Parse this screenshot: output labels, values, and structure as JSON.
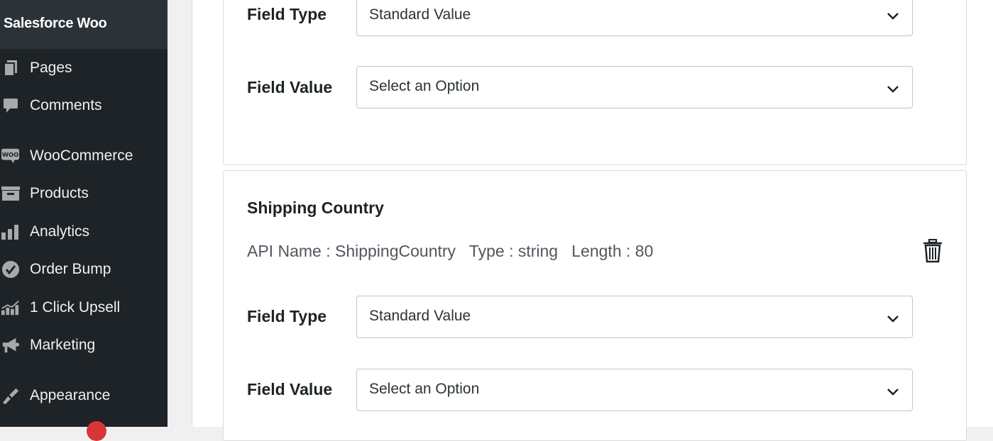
{
  "sidebar": {
    "current_title": "Salesforce Woo",
    "items": [
      {
        "label": "Pages",
        "icon": "pages-icon"
      },
      {
        "label": "Comments",
        "icon": "comments-icon"
      },
      {
        "label": "WooCommerce",
        "icon": "woocommerce-icon"
      },
      {
        "label": "Products",
        "icon": "products-icon"
      },
      {
        "label": "Analytics",
        "icon": "analytics-icon"
      },
      {
        "label": "Order Bump",
        "icon": "order-bump-icon"
      },
      {
        "label": "1 Click Upsell",
        "icon": "upsell-icon"
      },
      {
        "label": "Marketing",
        "icon": "marketing-icon"
      },
      {
        "label": "Appearance",
        "icon": "appearance-icon"
      }
    ],
    "woo_badge": "WOO"
  },
  "card1": {
    "field_type_label": "Field Type",
    "field_type_value": "Standard Value",
    "field_value_label": "Field Value",
    "field_value_value": "Select an Option"
  },
  "card2": {
    "title": "Shipping Country",
    "api_name": "API Name : ShippingCountry",
    "type": "Type : string",
    "length": "Length : 80",
    "field_type_label": "Field Type",
    "field_type_value": "Standard Value",
    "field_value_label": "Field Value",
    "field_value_value": "Select an Option"
  },
  "colors": {
    "sidebar_bg": "#1d2327",
    "sidebar_current": "#2c3338",
    "notification": "#d63638"
  }
}
